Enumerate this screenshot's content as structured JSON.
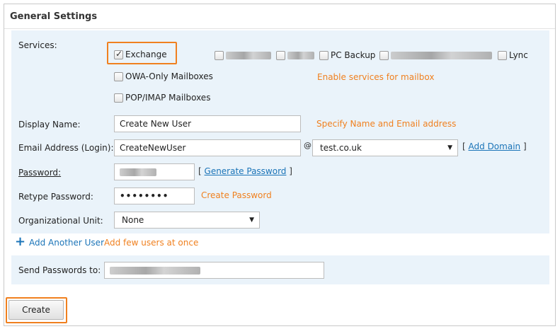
{
  "panel": {
    "title": "General Settings"
  },
  "services": {
    "label": "Services:",
    "exchange": {
      "label": "Exchange",
      "checked": true
    },
    "owa": {
      "label": "OWA-Only Mailboxes",
      "checked": false
    },
    "pop": {
      "label": "POP/IMAP Mailboxes",
      "checked": false
    },
    "pc_backup": {
      "label": "PC Backup",
      "checked": false
    },
    "lync": {
      "label": "Lync",
      "checked": false
    },
    "hint": "Enable services for mailbox"
  },
  "display_name": {
    "label": "Display Name:",
    "value": "Create New User",
    "hint": "Specify Name and Email address"
  },
  "email": {
    "label": "Email Address (Login):",
    "value": "CreateNewUser",
    "at": "@",
    "domain": "test.co.uk",
    "bracket_open": "[",
    "add_domain": "Add Domain",
    "bracket_close": "]"
  },
  "password": {
    "label": "Password:",
    "bracket_open": "[",
    "generate": "Generate Password",
    "bracket_close": "]"
  },
  "retype": {
    "label": "Retype Password:",
    "value": "••••••••",
    "hint": "Create Password"
  },
  "org_unit": {
    "label": "Organizational Unit:",
    "value": "None"
  },
  "add_user": {
    "label": "Add Another User",
    "hint": "Add few users at once"
  },
  "send_passwords": {
    "label": "Send Passwords to:"
  },
  "create_button": "Create",
  "colors": {
    "accent": "#f0801f",
    "link": "#1b74b8",
    "section_bg": "#eaf3fa"
  }
}
